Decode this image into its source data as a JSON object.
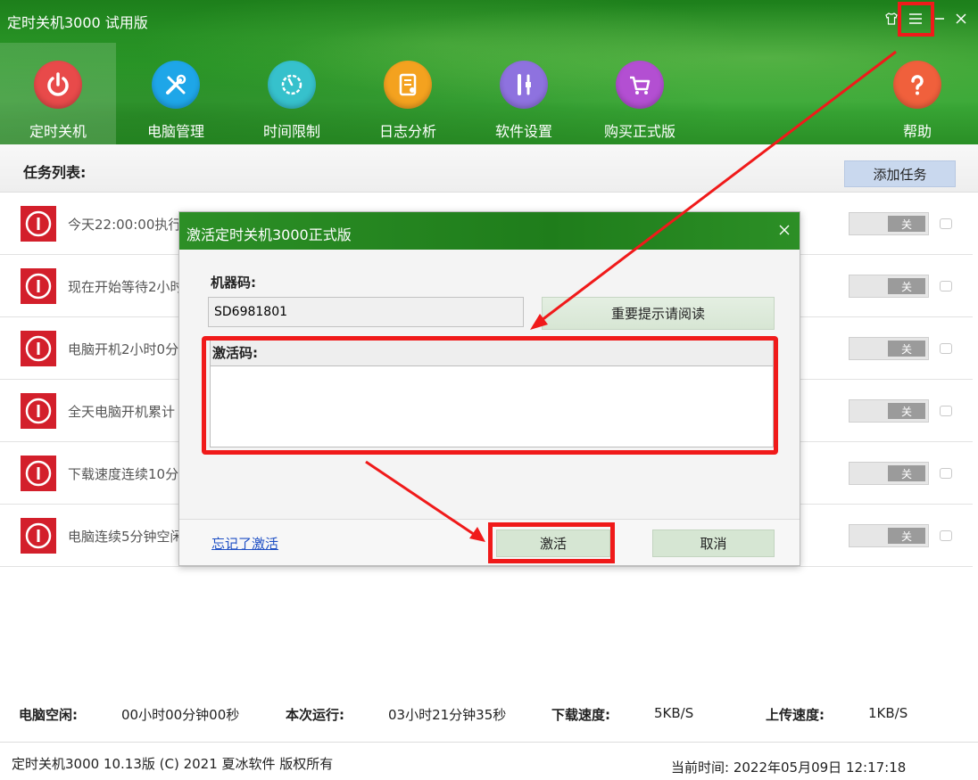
{
  "window": {
    "title": "定时关机3000 试用版",
    "controls": {
      "skin": "shirt-icon",
      "menu": "☰",
      "minimize": "—",
      "close": "✕"
    }
  },
  "nav": [
    {
      "label": "定时关机",
      "icon": "power-icon",
      "color": "#e84a4a",
      "active": true
    },
    {
      "label": "电脑管理",
      "icon": "tools-icon",
      "color": "#1ea6e8"
    },
    {
      "label": "时间限制",
      "icon": "timer-icon",
      "color": "#36c1cc"
    },
    {
      "label": "日志分析",
      "icon": "report-icon",
      "color": "#f4a21f"
    },
    {
      "label": "软件设置",
      "icon": "settings-tools-icon",
      "color": "#8e72df"
    },
    {
      "label": "购买正式版",
      "icon": "cart-icon",
      "color": "#b34fd2"
    },
    {
      "label": "帮助",
      "icon": "help-icon",
      "color": "#f0603c"
    }
  ],
  "task_list": {
    "title": "任务列表:",
    "add_button": "添加任务",
    "toggle_label": "关",
    "rows": [
      {
        "text": "今天22:00:00执行"
      },
      {
        "text": "现在开始等待2小时"
      },
      {
        "text": "电脑开机2小时0分"
      },
      {
        "text": "全天电脑开机累计"
      },
      {
        "text": "下载速度连续10分"
      },
      {
        "text": "电脑连续5分钟空闲"
      }
    ]
  },
  "status": {
    "idle_label": "电脑空闲:",
    "idle_value": "00小时00分钟00秒",
    "run_label": "本次运行:",
    "run_value": "03小时21分钟35秒",
    "down_label": "下载速度:",
    "down_value": "5KB/S",
    "up_label": "上传速度:",
    "up_value": "1KB/S"
  },
  "footer": {
    "copyright": "定时关机3000  10.13版  (C)  2021  夏冰软件 版权所有",
    "time": "当前时间:  2022年05月09日  12:17:18"
  },
  "dialog": {
    "title": "激活定时关机3000正式版",
    "close": "✕",
    "machine_label": "机器码:",
    "machine_code": "SD6981801",
    "notice_button": "重要提示请阅读",
    "activation_label": "激活码:",
    "activation_value": "",
    "forgot_link": "忘记了激活",
    "activate_button": "激活",
    "cancel_button": "取消"
  },
  "colors": {
    "header_green": "#2d9d2a",
    "highlight_red": "#f01a1a",
    "task_red": "#d31f2b"
  }
}
